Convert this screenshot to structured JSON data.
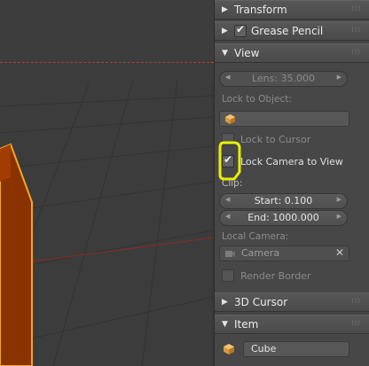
{
  "panel": {
    "transform": {
      "label": "Transform"
    },
    "grease_pencil": {
      "label": "Grease Pencil",
      "checked": true
    },
    "view": {
      "label": "View",
      "lens": "Lens: 35.000",
      "lock_to_object_label": "Lock to Object:",
      "lock_to_cursor_label": "Lock to Cursor",
      "lock_camera_to_view_label": "Lock Camera to View",
      "lock_camera_to_view_checked": true,
      "clip_label": "Clip:",
      "clip_start": "Start: 0.100",
      "clip_end": "End: 1000.000",
      "local_camera_label": "Local Camera:",
      "local_camera_value": "Camera",
      "render_border_label": "Render Border"
    },
    "cursor_3d": {
      "label": "3D Cursor"
    },
    "item": {
      "label": "Item",
      "name_value": "Cube"
    }
  },
  "colors": {
    "cube_fill": "#8a3200",
    "cube_outline": "#f5a623",
    "highlight_marker": "#e8f000",
    "grid_red_axis": "#8b2a2a"
  },
  "icons": [
    "cube-icon",
    "checkmark-icon",
    "clear-x-icon",
    "triangle-right-icon",
    "triangle-down-icon",
    "drag-grip-icon"
  ]
}
